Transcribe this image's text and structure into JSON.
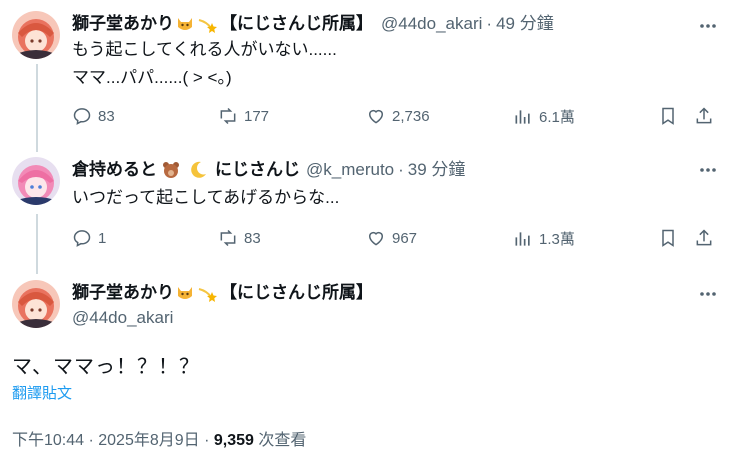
{
  "tweets": [
    {
      "name": "獅子堂あかり",
      "affiliation": "【にじさんじ所属】",
      "handle": "@44do_akari",
      "separator": "·",
      "time": "49 分鐘",
      "text": "もう起こしてくれる人がいない......\nママ...パパ......( > <。)",
      "replies": "83",
      "reposts": "177",
      "likes": "2,736",
      "views": "6.1萬"
    },
    {
      "name": "倉持めると",
      "affiliation": "にじさんじ",
      "handle": "@k_meruto",
      "separator": "·",
      "time": "39 分鐘",
      "text": "いつだって起こしてあげるからな...",
      "replies": "1",
      "reposts": "83",
      "likes": "967",
      "views": "1.3萬"
    }
  ],
  "main_tweet": {
    "name": "獅子堂あかり",
    "affiliation": "【にじさんじ所属】",
    "handle": "@44do_akari",
    "text": "マ、ママっ！？！？",
    "translate_label": "翻譯貼文",
    "timestamp": "下午10:44 · 2025年8月9日 · ",
    "views_count": "9,359",
    "views_label": " 次查看"
  },
  "icons": {
    "reply": "reply-icon",
    "repost": "repost-icon",
    "like": "heart-icon",
    "views": "analytics-icon",
    "bookmark": "bookmark-icon",
    "share": "share-icon",
    "more": "more-icon"
  },
  "colors": {
    "text": "#0f1419",
    "muted": "#536471",
    "link": "#1d9bf0",
    "thread_line": "#cfd9de"
  }
}
